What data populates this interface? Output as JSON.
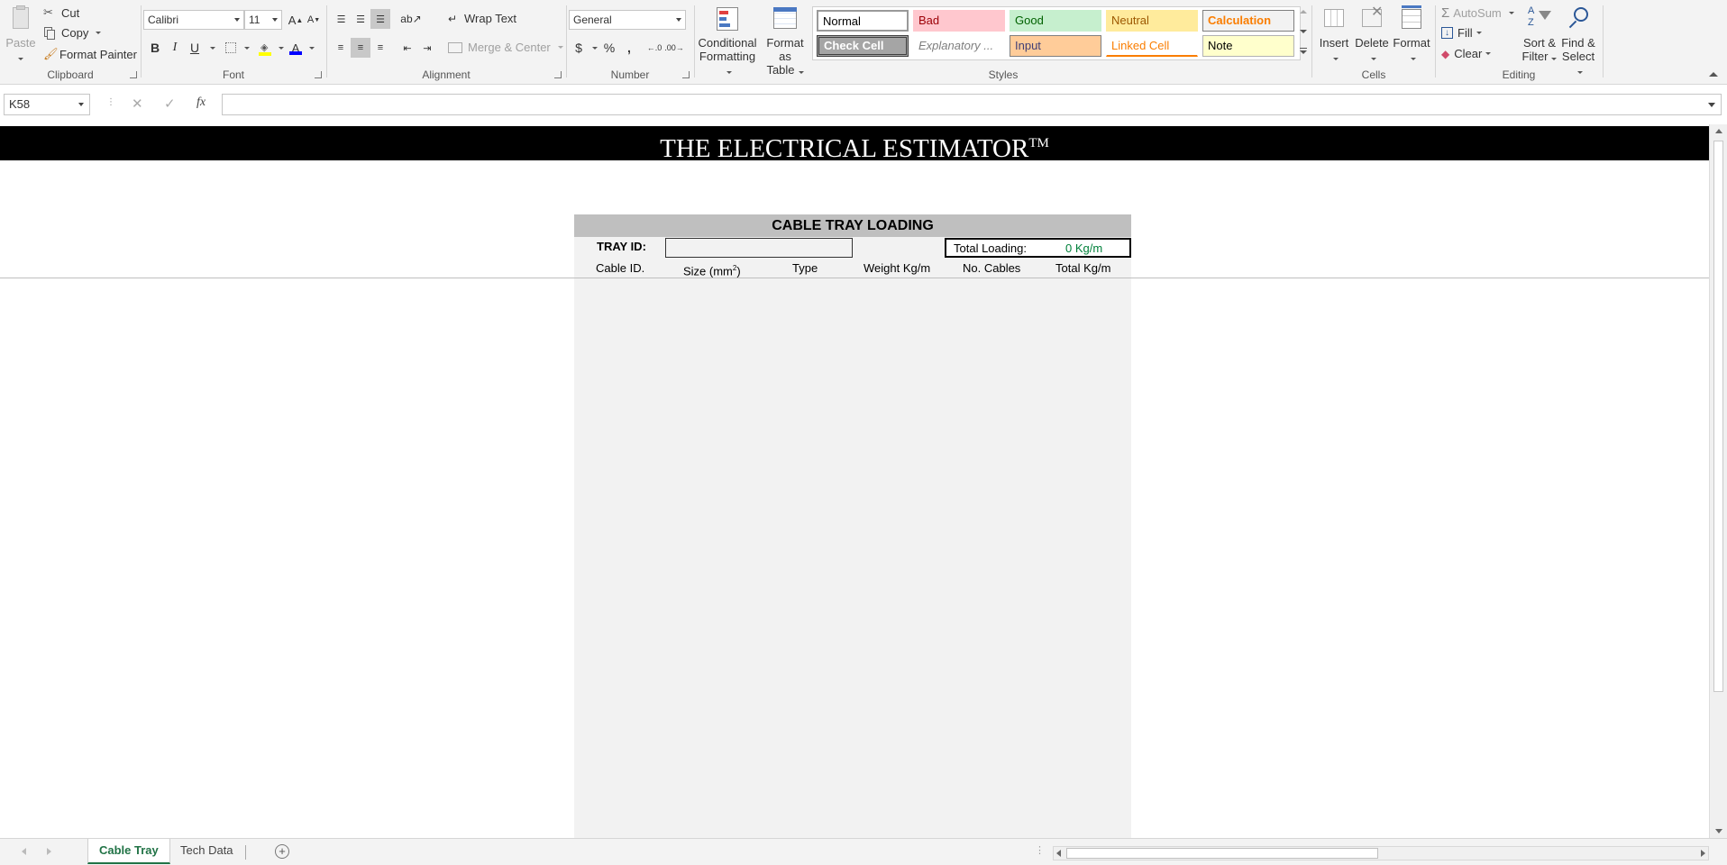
{
  "ribbon": {
    "clipboard": {
      "label": "Clipboard",
      "paste": "Paste",
      "cut": "Cut",
      "copy": "Copy",
      "format_painter": "Format Painter"
    },
    "font": {
      "label": "Font",
      "family": "Calibri",
      "size": "11",
      "bold": "B",
      "italic": "I",
      "underline": "U",
      "grow": "A",
      "shrink": "A"
    },
    "alignment": {
      "label": "Alignment",
      "wrap_text": "Wrap Text",
      "merge_center": "Merge & Center"
    },
    "number": {
      "label": "Number",
      "format": "General",
      "currency": "$",
      "percent": "%",
      "comma": ","
    },
    "styles": {
      "label": "Styles",
      "conditional_formatting": [
        "Conditional",
        "Formatting"
      ],
      "format_as_table": [
        "Format as",
        "Table"
      ],
      "cells": [
        {
          "label": "Normal",
          "bg": "#ffffff",
          "fg": "#000000",
          "border": "#999999"
        },
        {
          "label": "Bad",
          "bg": "#ffc7ce",
          "fg": "#9c0006",
          "border": "#ffc7ce"
        },
        {
          "label": "Good",
          "bg": "#c6efce",
          "fg": "#006100",
          "border": "#c6efce"
        },
        {
          "label": "Neutral",
          "bg": "#ffeb9c",
          "fg": "#9c5700",
          "border": "#ffeb9c"
        },
        {
          "label": "Calculation",
          "bg": "#f2f2f2",
          "fg": "#fa7d00",
          "border": "#7f7f7f"
        },
        {
          "label": "Check Cell",
          "bg": "#a5a5a5",
          "fg": "#ffffff",
          "border": "#3f3f3f"
        },
        {
          "label": "Explanatory ...",
          "bg": "#ffffff",
          "fg": "#7f7f7f",
          "border": "#ffffff"
        },
        {
          "label": "Input",
          "bg": "#ffcc99",
          "fg": "#3f3f76",
          "border": "#7f7f7f"
        },
        {
          "label": "Linked Cell",
          "bg": "#ffffff",
          "fg": "#fa7d00",
          "border": "#ffffff"
        },
        {
          "label": "Note",
          "bg": "#ffffcc",
          "fg": "#000000",
          "border": "#b2b2b2"
        }
      ]
    },
    "cells": {
      "label": "Cells",
      "insert": "Insert",
      "delete": "Delete",
      "format": "Format"
    },
    "editing": {
      "label": "Editing",
      "autosum": "AutoSum",
      "fill": "Fill",
      "clear": "Clear",
      "sort_filter": [
        "Sort &",
        "Filter"
      ],
      "find_select": [
        "Find &",
        "Select"
      ]
    }
  },
  "formula_bar": {
    "name_box": "K58",
    "fx": "fx",
    "formula": ""
  },
  "sheet": {
    "banner": "THE ELECTRICAL ESTIMATOR",
    "banner_mark": "TM",
    "title": "CABLE TRAY LOADING",
    "tray_id_label": "TRAY ID:",
    "tray_id_value": "",
    "total_loading_label": "Total Loading:",
    "total_loading_value": "0 Kg/m",
    "columns": [
      "Cable ID.",
      "Size (mm",
      "Type",
      "Weight Kg/m",
      "No. Cables",
      "Total Kg/m"
    ],
    "size_suffix_sup": "2",
    "size_suffix_close": ")",
    "value_color": "#00803a",
    "panel_color": "#f2f2f2",
    "title_bg": "#bfbfbf"
  },
  "tabs": {
    "items": [
      "Cable Tray",
      "Tech Data"
    ],
    "active": "Cable Tray",
    "accent": "#217346"
  }
}
